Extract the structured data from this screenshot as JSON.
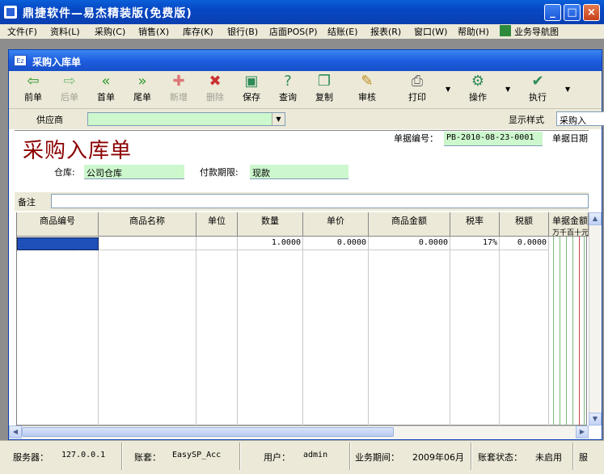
{
  "window": {
    "title": "鼎捷软件—易杰精装版(免费版)",
    "min": "_",
    "max": "□",
    "close": "×"
  },
  "menubar": {
    "items": [
      "文件(F)",
      "资料(L)",
      "采购(C)",
      "销售(X)",
      "库存(K)",
      "银行(B)",
      "店面POS(P)",
      "结账(E)",
      "报表(R)",
      "窗口(W)",
      "帮助(H)",
      "业务导航图"
    ]
  },
  "child_window": {
    "title": "采购入库单",
    "icon_text": "Ez"
  },
  "toolbar": {
    "buttons": [
      {
        "label": "前单",
        "icon": "arrow-left-icon"
      },
      {
        "label": "后单",
        "icon": "arrow-right-icon",
        "disabled": true
      },
      {
        "label": "首单",
        "icon": "first-icon"
      },
      {
        "label": "尾单",
        "icon": "last-icon"
      },
      {
        "label": "新增",
        "icon": "new-icon",
        "disabled": true
      },
      {
        "label": "删除",
        "icon": "delete-icon",
        "disabled": true
      },
      {
        "label": "保存",
        "icon": "save-icon"
      },
      {
        "label": "查询",
        "icon": "query-icon"
      },
      {
        "label": "复制",
        "icon": "copy-icon"
      },
      {
        "label": "审核",
        "icon": "audit-icon"
      },
      {
        "label": "打印",
        "icon": "print-icon"
      },
      {
        "label": "操作",
        "icon": "operate-icon"
      },
      {
        "label": "执行",
        "icon": "execute-icon"
      }
    ]
  },
  "form": {
    "supplier_label": "供应商",
    "supplier_value": "",
    "display_style_label": "显示样式",
    "display_style_value": "采购入",
    "doc_title": "采购入库单",
    "doc_no_label": "单据编号：",
    "doc_no": "PB-2010-08-23-0001",
    "doc_date_label": "单据日期",
    "warehouse_label": "仓库:",
    "warehouse_value": "公司仓库",
    "payment_term_label": "付款期限:",
    "payment_term_value": "现款",
    "remark_label": "备注",
    "remark_value": ""
  },
  "grid": {
    "columns": [
      "商品编号",
      "商品名称",
      "单位",
      "数量",
      "单价",
      "商品金额",
      "税率",
      "税额",
      "单据金额"
    ],
    "amount_subheader": "万千百十元",
    "rows": [
      {
        "code": "",
        "name": "",
        "unit": "",
        "qty": "1.0000",
        "price": "0.0000",
        "amount": "0.0000",
        "tax_rate": "17%",
        "tax": "0.0000"
      }
    ]
  },
  "statusbar": {
    "server_label": "服务器：",
    "server_value": "127.0.0.1",
    "account_label": "账套：",
    "account_value": "EasySP_Acc",
    "user_label": "用户：",
    "user_value": "admin",
    "period_label": "业务期间：",
    "period_value": "2009年06月",
    "account_status_label": "账套状态：",
    "account_status_value": "未启用",
    "tail": "服"
  }
}
